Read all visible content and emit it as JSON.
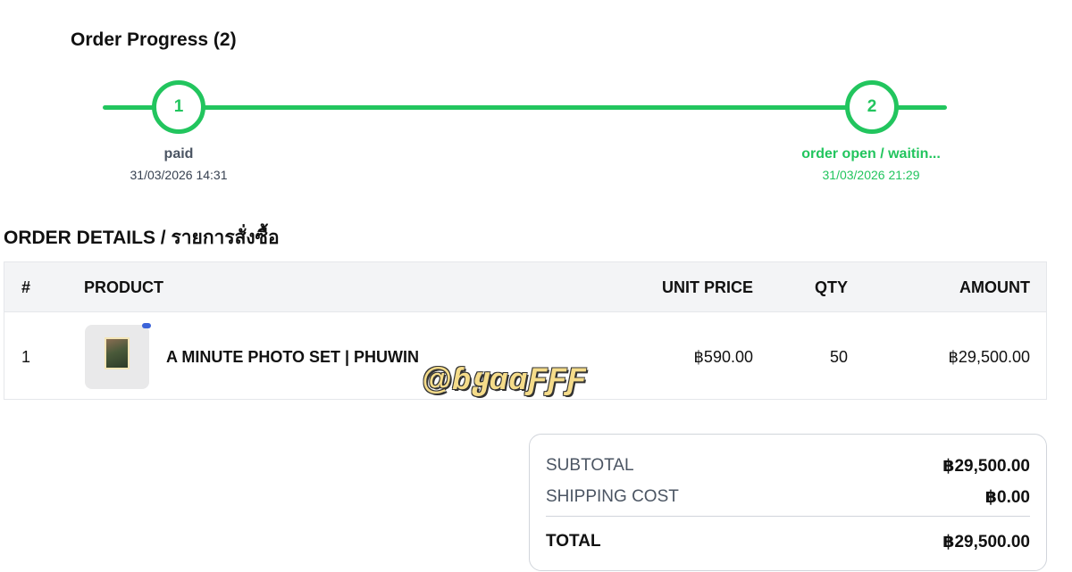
{
  "progress": {
    "title": "Order Progress (2)",
    "accent_color": "#22c55e",
    "steps": [
      {
        "number": "1",
        "label": "paid",
        "date": "31/03/2026 14:31"
      },
      {
        "number": "2",
        "label": "order open / waitin...",
        "date": "31/03/2026 21:29"
      }
    ]
  },
  "details": {
    "title": "ORDER DETAILS / รายการสั่งซื้อ",
    "columns": {
      "index": "#",
      "product": "PRODUCT",
      "unit_price": "UNIT PRICE",
      "qty": "QTY",
      "amount": "AMOUNT"
    },
    "rows": [
      {
        "index": "1",
        "product": "A MINUTE PHOTO SET | PHUWIN",
        "unit_price": "฿590.00",
        "qty": "50",
        "amount": "฿29,500.00"
      }
    ]
  },
  "watermark": "@ɓყɑɑƑƑƑ",
  "summary": {
    "subtotal_label": "SUBTOTAL",
    "subtotal_value": "฿29,500.00",
    "shipping_label": "SHIPPING COST",
    "shipping_value": "฿0.00",
    "total_label": "TOTAL",
    "total_value": "฿29,500.00"
  }
}
